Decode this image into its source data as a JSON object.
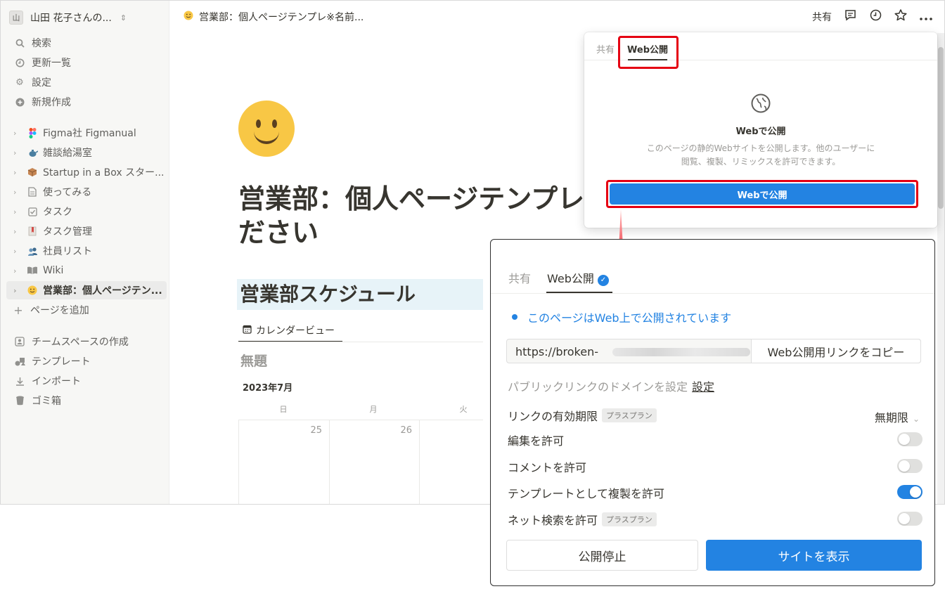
{
  "sidebar": {
    "workspace": {
      "avatar": "山",
      "name": "山田 花子さんの...",
      "chevron": "⌃⌄"
    },
    "nav": [
      {
        "icon": "search-icon",
        "glyph": "🔍︎",
        "label": "検索"
      },
      {
        "icon": "clock-icon",
        "glyph": "◷",
        "label": "更新一覧"
      },
      {
        "icon": "gear-icon",
        "glyph": "⚙",
        "label": "設定"
      },
      {
        "icon": "plus-circle-icon",
        "glyph": "⊕",
        "label": "新規作成"
      }
    ],
    "pages": [
      {
        "icon": "figma-icon",
        "glyph": "◆",
        "color": "#f24e1e",
        "label": "Figma社 Figmanual"
      },
      {
        "icon": "teapot-icon",
        "glyph": "🫖",
        "color": "#4a7fa0",
        "label": "雑談給湯室"
      },
      {
        "icon": "box-icon",
        "glyph": "📦",
        "color": "#b0784a",
        "label": "Startup in a Box スター..."
      },
      {
        "icon": "document-icon",
        "glyph": "🗎",
        "color": "#91918e",
        "label": "使ってみる"
      },
      {
        "icon": "checkbox-icon",
        "glyph": "☑",
        "color": "#91918e",
        "label": "タスク"
      },
      {
        "icon": "bookmark-icon",
        "glyph": "🔖",
        "color": "#d44c47",
        "label": "タスク管理"
      },
      {
        "icon": "people-icon",
        "glyph": "👥",
        "color": "#3f6b8f",
        "label": "社員リスト"
      },
      {
        "icon": "book-icon",
        "glyph": "📖",
        "color": "#91918e",
        "label": "Wiki"
      },
      {
        "icon": "smiley-icon",
        "glyph": "🙂",
        "color": "#e6a700",
        "label": "営業部：個人ページテン..."
      }
    ],
    "add_page": "ページを追加",
    "footer": [
      {
        "icon": "teamspace-icon",
        "glyph": "⊡",
        "label": "チームスペースの作成"
      },
      {
        "icon": "template-icon",
        "glyph": "❖",
        "label": "テンプレート"
      },
      {
        "icon": "import-icon",
        "glyph": "⤓",
        "label": "インポート"
      },
      {
        "icon": "trash-icon",
        "glyph": "🗑",
        "label": "ゴミ箱"
      }
    ]
  },
  "topbar": {
    "breadcrumb": "営業部：個人ページテンプレ※名前...",
    "share": "共有"
  },
  "page": {
    "title_line1": "営業部：個人ページテンプレ",
    "title_line2": "ださい",
    "heading": "営業部スケジュール",
    "view_tab": "カレンダービュー",
    "db_title": "無題",
    "month": "2023年7月",
    "weekdays": [
      "日",
      "月",
      "火"
    ],
    "days": [
      "25",
      "26",
      ""
    ]
  },
  "popup_top": {
    "tab_share": "共有",
    "tab_web": "Web公開",
    "heading": "Webで公開",
    "description_line1": "このページの静的Webサイトを公開します。他のユーザーに",
    "description_line2": "閲覧、複製、リミックスを許可できます。",
    "button": "Webで公開"
  },
  "popup_bottom": {
    "tab_share": "共有",
    "tab_web": "Web公開",
    "check": "✓",
    "status": "このページはWeb上で公開されています",
    "url_prefix": "https://broken-",
    "copy_button": "Web公開用リンクをコピー",
    "domain_label": "パブリックリンクのドメインを設定",
    "domain_link": "設定",
    "options": [
      {
        "label": "リンクの有効期限",
        "badge": "プラスプラン",
        "value": "無期限"
      },
      {
        "label": "編集を許可",
        "on": false
      },
      {
        "label": "コメントを許可",
        "on": false
      },
      {
        "label": "テンプレートとして複製を許可",
        "on": true
      },
      {
        "label": "ネット検索を許可",
        "badge": "プラスプラン",
        "on": false
      }
    ],
    "unpublish_button": "公開停止",
    "view_site_button": "サイトを表示"
  },
  "colors": {
    "accent": "#2383e2",
    "highlight": "#e50012",
    "heading_bg": "#e7f3f8"
  }
}
